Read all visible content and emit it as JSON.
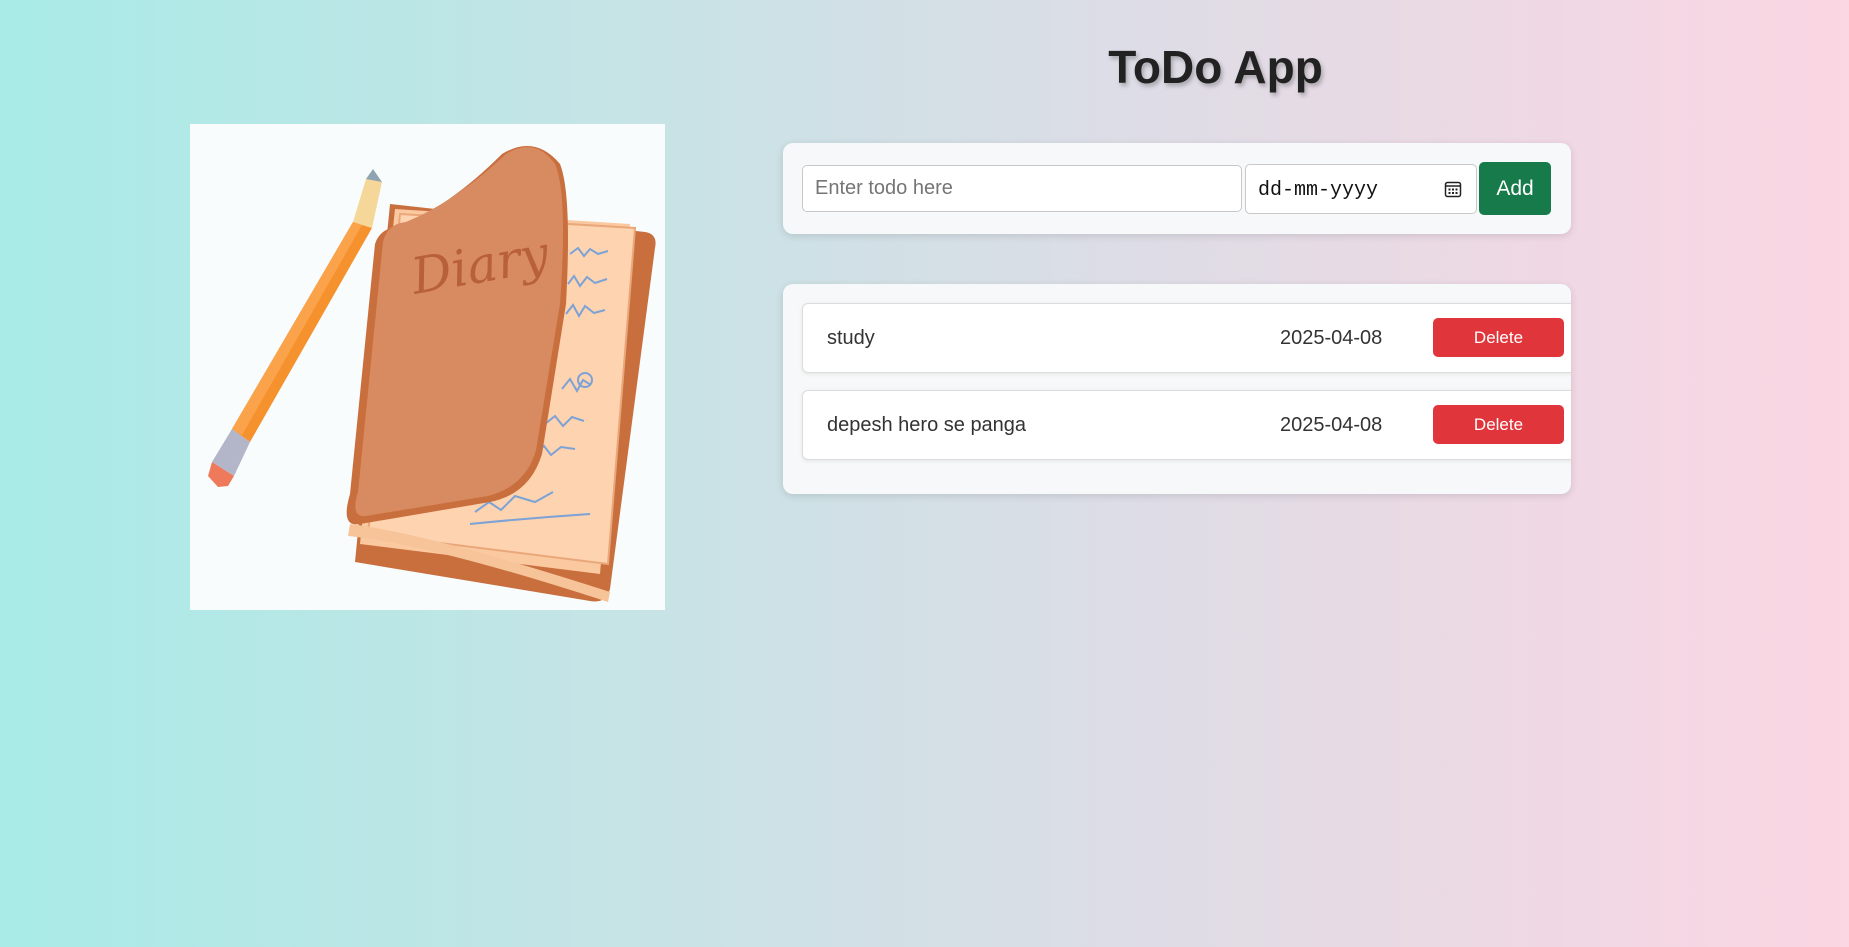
{
  "app": {
    "title": "ToDo App"
  },
  "form": {
    "todo_placeholder": "Enter todo here",
    "date_placeholder": "dd-mm-yyyy",
    "add_label": "Add"
  },
  "todos": [
    {
      "text": "study",
      "date": "2025-04-08",
      "delete_label": "Delete"
    },
    {
      "text": "depesh hero se panga",
      "date": "2025-04-08",
      "delete_label": "Delete"
    }
  ],
  "illustration": {
    "cover_text": "Diary"
  },
  "colors": {
    "add_button": "#167a4a",
    "delete_button": "#e0363b",
    "diary_cover": "#d88a60",
    "pencil": "#f5922e"
  },
  "icons": {
    "date_picker": "calendar-icon"
  }
}
